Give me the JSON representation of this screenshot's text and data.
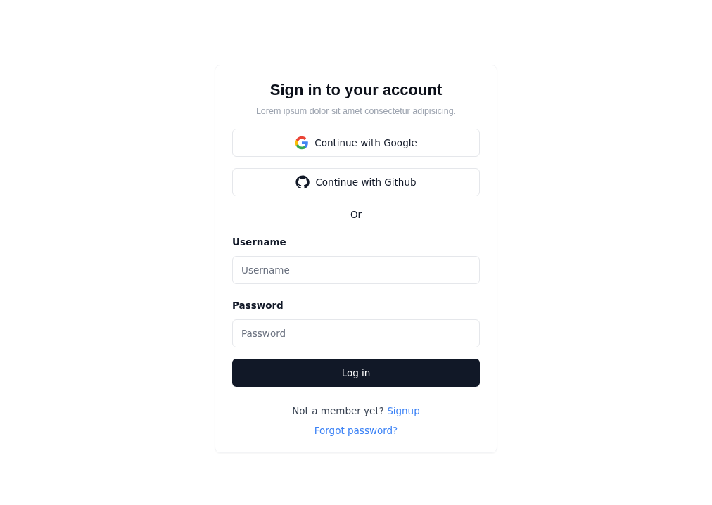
{
  "title": "Sign in to your account",
  "subtitle": "Lorem ipsum dolor sit amet consectetur adipisicing.",
  "providers": [
    {
      "kind": "google",
      "label": "Continue with Google"
    },
    {
      "kind": "github",
      "label": "Continue with Github"
    }
  ],
  "divider": "Or",
  "fields": [
    {
      "label": "Username",
      "placeholder": "Username"
    },
    {
      "label": "Password",
      "placeholder": "Password"
    }
  ],
  "submit": "Log in",
  "signup": {
    "prompt": "Not a member yet?",
    "link": "Signup"
  },
  "forgot": "Forgot password?"
}
